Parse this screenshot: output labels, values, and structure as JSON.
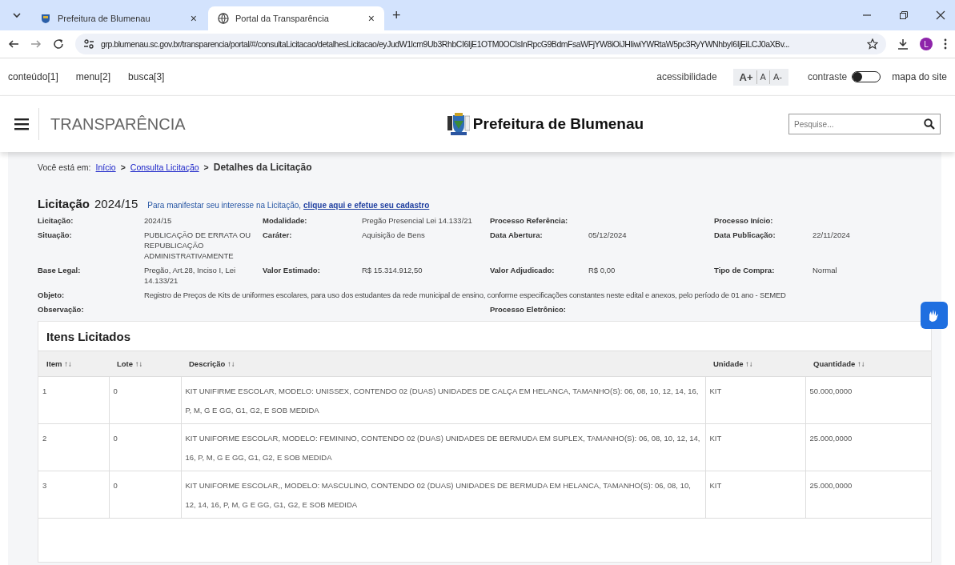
{
  "browser": {
    "tabs": [
      {
        "title": "Prefeitura de Blumenau",
        "kind": "crest",
        "selected": false
      },
      {
        "title": "Portal da Transparência",
        "kind": "globe",
        "selected": true
      }
    ],
    "close_glyph": "×",
    "new_tab_glyph": "+",
    "address": "grp.blumenau.sc.gov.br/transparencia/portal/#/consultaLicitacao/detalhesLicitacao/eyJudW1lcm9Ub3RhbCI6IjE1OTM0OCIsInRpcG9BdmFsaWFjYW8iOiJHIiwiYWRtaW5pc3RyYWNhbyI6IjEiLCJ0aXBv...",
    "profile": "L"
  },
  "skip_links": [
    "conteúdo[1]",
    "menu[2]",
    "busca[3]"
  ],
  "accessibility": {
    "label": "acessibilidade",
    "font_buttons": [
      "A+",
      "A",
      "A-"
    ],
    "contrast_label": "contraste",
    "contrast_on": false,
    "sitemap": "mapa do site"
  },
  "header": {
    "title": "TRANSPARÊNCIA",
    "brand": "Prefeitura de Blumenau",
    "search_placeholder": "Pesquise..."
  },
  "breadcrumb": {
    "prefix": "Você está em:",
    "links": [
      "Início",
      "Consulta Licitação"
    ],
    "separator": ">",
    "current": "Detalhes da Licitação"
  },
  "licitacao": {
    "heading": "Licitação",
    "number": "2024/15",
    "notice": "Para manifestar seu interesse na Licitação,",
    "notice_link": "clique aqui e efetue seu cadastro"
  },
  "fields": [
    {
      "kind": "grid",
      "cells": [
        {
          "label": "Licitação:",
          "value": "2024/15"
        },
        {
          "label": "Modalidade:",
          "value": "Pregão Presencial Lei 14.133/21"
        },
        {
          "label": "Processo Referência:"
        },
        {
          "label": "Processo Início:"
        }
      ]
    },
    {
      "kind": "grid",
      "cells": [
        {
          "label": "Situação:",
          "value": "PUBLICAÇÃO DE ERRATA OU REPUBLICAÇÃO ADMINISTRATIVAMENTE"
        },
        {
          "label": "Caráter:",
          "value": "Aquisição de Bens"
        },
        {
          "label": "Data Abertura:",
          "value": "05/12/2024"
        },
        {
          "label": "Data Publicação:",
          "value": "22/11/2024"
        }
      ]
    },
    {
      "kind": "grid",
      "cells": [
        {
          "label": "Base Legal:",
          "value": "Pregão, Art.28, Inciso I, Lei 14.133/21"
        },
        {
          "label": "Valor Estimado:",
          "value": "R$ 15.314.912,50"
        },
        {
          "label": "Valor Adjudicado:",
          "value": "R$ 0,00"
        },
        {
          "label": "Tipo de Compra:",
          "value": "Normal"
        }
      ]
    },
    {
      "kind": "wide",
      "cells": [
        {
          "label": "Objeto:",
          "value": "Registro de Preços de Kits de uniformes escolares, para uso dos estudantes da rede municipal de ensino, conforme especificações constantes neste edital e anexos, pelo período de 01 ano - SEMED"
        }
      ]
    },
    {
      "kind": "grid",
      "cells": [
        {
          "label": "Observação:"
        },
        null,
        {
          "label": "Processo Eletrônico:"
        }
      ]
    }
  ],
  "items": {
    "title": "Itens Licitados",
    "sort_glyph": "↑↓",
    "columns": [
      "Item",
      "Lote",
      "Descrição",
      "Unidade",
      "Quantidade"
    ],
    "rows": [
      [
        "1",
        "0",
        "KIT UNIFIRME ESCOLAR, MODELO: UNISSEX, CONTENDO 02 (DUAS) UNIDADES DE CALÇA EM HELANCA, TAMANHO(S): 06, 08, 10, 12, 14, 16, P, M, G E GG, G1, G2, E SOB MEDIDA",
        "KIT",
        "50.000,0000"
      ],
      [
        "2",
        "0",
        "KIT UNIFORME ESCOLAR, MODELO: FEMININO, CONTENDO 02 (DUAS) UNIDADES DE BERMUDA EM SUPLEX, TAMANHO(S): 06, 08, 10, 12, 14, 16, P, M, G E GG, G1, G2, E SOB MEDIDA",
        "KIT",
        "25.000,0000"
      ],
      [
        "3",
        "0",
        "KIT UNIFORME ESCOLAR,, MODELO: MASCULINO, CONTENDO 02 (DUAS) UNIDADES DE BERMUDA EM HELANCA, TAMANHO(S): 06, 08, 10, 12, 14, 16, P, M, G E GG, G1, G2, E SOB MEDIDA",
        "KIT",
        "25.000,0000"
      ]
    ]
  }
}
